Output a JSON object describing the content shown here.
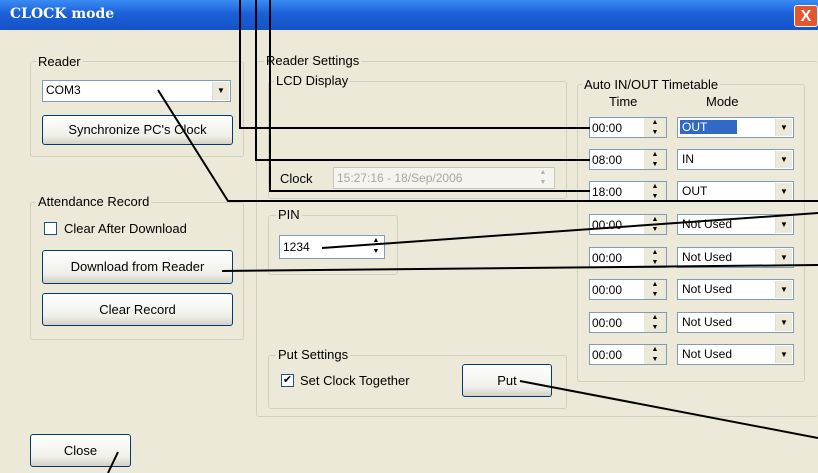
{
  "window": {
    "title": "CLOCK mode",
    "close_glyph": "X"
  },
  "reader": {
    "group_label": "Reader",
    "port_value": "COM3",
    "sync_button": "Synchronize PC's Clock"
  },
  "attendance": {
    "group_label": "Attendance Record",
    "clear_after_download": "Clear After Download",
    "download_button": "Download from Reader",
    "clear_button": "Clear Record"
  },
  "reader_settings": {
    "group_label": "Reader Settings",
    "lcd": {
      "group_label": "LCD Display",
      "clock_label": "Clock",
      "clock_value": "15:27:16 - 18/Sep/2006"
    },
    "pin": {
      "group_label": "PIN",
      "value": "1234"
    },
    "put_settings": {
      "group_label": "Put Settings",
      "set_clock_label": "Set Clock Together",
      "set_clock_checked": true,
      "put_button": "Put"
    }
  },
  "timetable": {
    "group_label": "Auto IN/OUT Timetable",
    "time_header": "Time",
    "mode_header": "Mode",
    "rows": [
      {
        "time": "00:00",
        "mode": "OUT"
      },
      {
        "time": "08:00",
        "mode": "IN"
      },
      {
        "time": "18:00",
        "mode": "OUT"
      },
      {
        "time": "00:00",
        "mode": "Not Used"
      },
      {
        "time": "00:00",
        "mode": "Not Used"
      },
      {
        "time": "00:00",
        "mode": "Not Used"
      },
      {
        "time": "00:00",
        "mode": "Not Used"
      },
      {
        "time": "00:00",
        "mode": "Not Used"
      }
    ]
  },
  "close_button": "Close",
  "icons": {
    "check": "✔",
    "combo_arrow": "▼",
    "spin_up": "▲",
    "spin_down": "▼"
  }
}
